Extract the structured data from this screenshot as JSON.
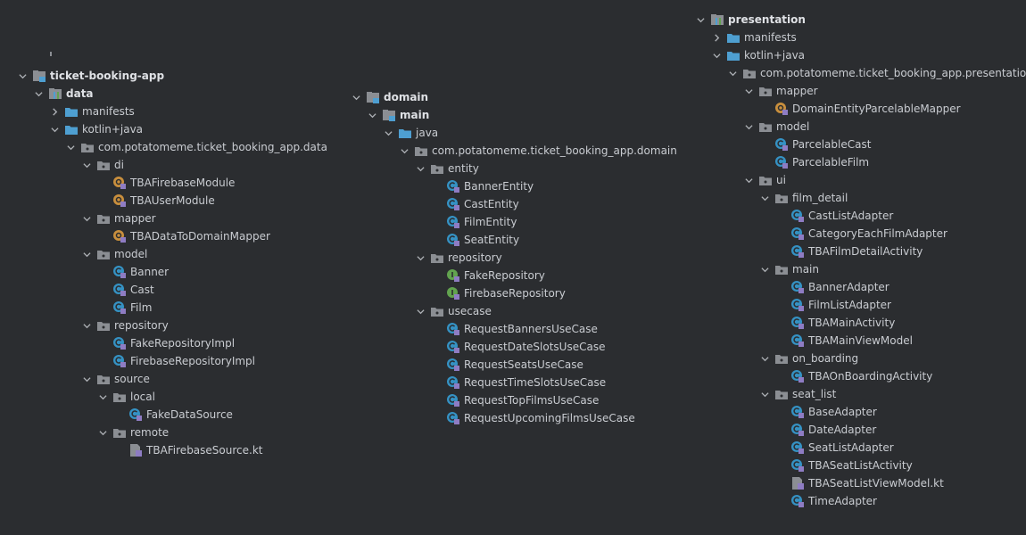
{
  "colors": {
    "background": "#2b2d30",
    "text": "#c9ccd1",
    "folder": "#4e9fd1",
    "package": "#8b8e93",
    "class": "#3592c4",
    "object": "#c98f3d",
    "interface": "#62a34f"
  },
  "left": {
    "root": "ticket-booking-app",
    "data": "data",
    "manifests": "manifests",
    "kotlin_java": "kotlin+java",
    "package": "com.potatomeme.ticket_booking_app.data",
    "di": "di",
    "tba_firebase_module": "TBAFirebaseModule",
    "tba_user_module": "TBAUserModule",
    "mapper": "mapper",
    "tba_data_to_domain_mapper": "TBADataToDomainMapper",
    "model": "model",
    "banner": "Banner",
    "cast": "Cast",
    "film": "Film",
    "repository": "repository",
    "fake_repository_impl": "FakeRepositoryImpl",
    "firebase_repository_impl": "FirebaseRepositoryImpl",
    "source": "source",
    "local": "local",
    "fake_data_source": "FakeDataSource",
    "remote": "remote",
    "tba_firebase_source": "TBAFirebaseSource.kt"
  },
  "middle": {
    "domain": "domain",
    "main": "main",
    "java": "java",
    "package": "com.potatomeme.ticket_booking_app.domain",
    "entity": "entity",
    "banner_entity": "BannerEntity",
    "cast_entity": "CastEntity",
    "film_entity": "FilmEntity",
    "seat_entity": "SeatEntity",
    "repository": "repository",
    "fake_repository": "FakeRepository",
    "firebase_repository": "FirebaseRepository",
    "usecase": "usecase",
    "request_banners": "RequestBannersUseCase",
    "request_date_slots": "RequestDateSlotsUseCase",
    "request_seats": "RequestSeatsUseCase",
    "request_time_slots": "RequestTimeSlotsUseCase",
    "request_top_films": "RequestTopFilmsUseCase",
    "request_upcoming_films": "RequestUpcomingFilmsUseCase"
  },
  "right": {
    "presentation": "presentation",
    "manifests": "manifests",
    "kotlin_java": "kotlin+java",
    "package": "com.potatomeme.ticket_booking_app.presentation",
    "mapper": "mapper",
    "domain_entity_parcelable_mapper": "DomainEntityParcelableMapper",
    "model": "model",
    "parcelable_cast": "ParcelableCast",
    "parcelable_film": "ParcelableFilm",
    "ui": "ui",
    "film_detail": "film_detail",
    "cast_list_adapter": "CastListAdapter",
    "category_each_film_adapter": "CategoryEachFilmAdapter",
    "tba_film_detail_activity": "TBAFilmDetailActivity",
    "main": "main",
    "banner_adapter": "BannerAdapter",
    "film_list_adapter": "FilmListAdapter",
    "tba_main_activity": "TBAMainActivity",
    "tba_main_view_model": "TBAMainViewModel",
    "on_boarding": "on_boarding",
    "tba_on_boarding_activity": "TBAOnBoardingActivity",
    "seat_list": "seat_list",
    "base_adapter": "BaseAdapter",
    "date_adapter": "DateAdapter",
    "seat_list_adapter": "SeatListAdapter",
    "tba_seat_list_activity": "TBASeatListActivity",
    "tba_seat_list_view_model": "TBASeatListViewModel.kt",
    "time_adapter": "TimeAdapter"
  }
}
